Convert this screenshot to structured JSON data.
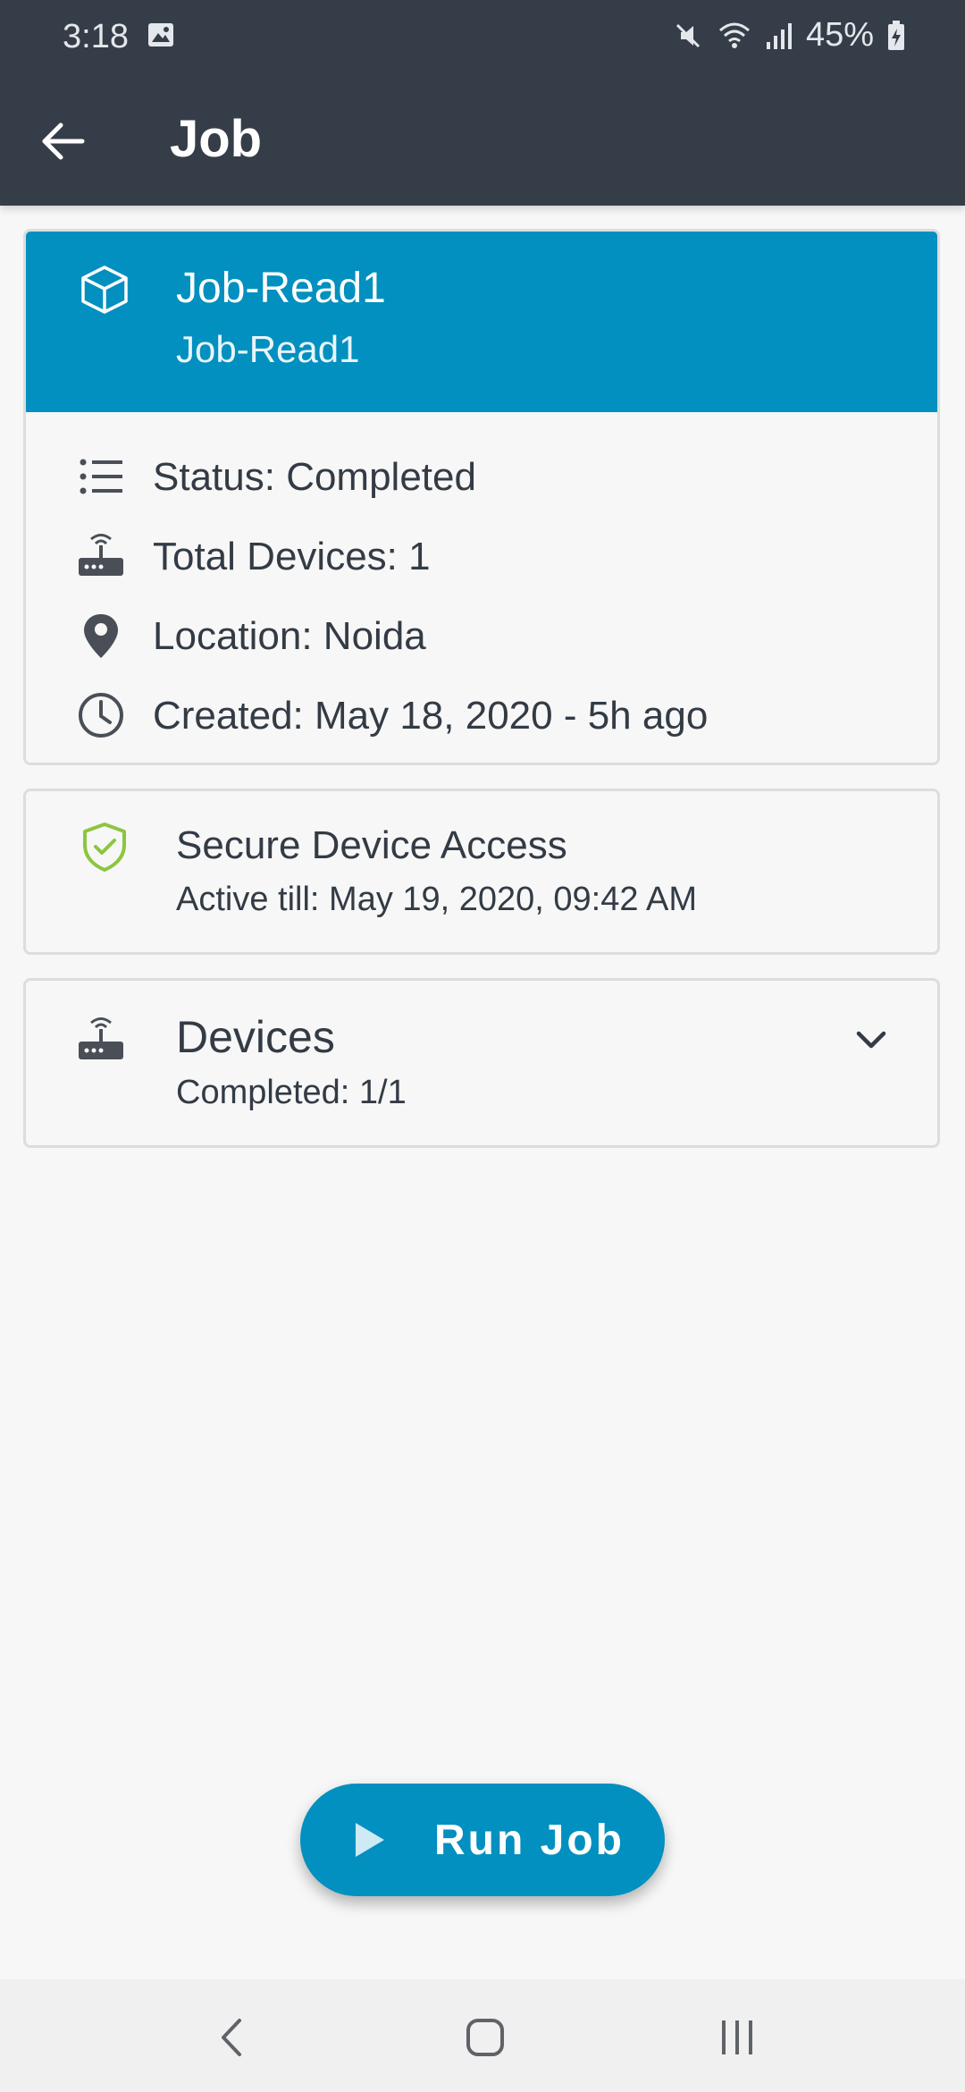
{
  "status_bar": {
    "time": "3:18",
    "battery": "45%"
  },
  "app_bar": {
    "title": "Job",
    "back_icon": "arrow-left-icon"
  },
  "job": {
    "name": "Job-Read1",
    "subtitle": "Job-Read1",
    "details": [
      {
        "icon": "list-icon",
        "text": "Status: Completed"
      },
      {
        "icon": "router-icon",
        "text": "Total Devices: 1"
      },
      {
        "icon": "location-pin-icon",
        "text": "Location: Noida"
      },
      {
        "icon": "clock-icon",
        "text": "Created: May 18, 2020 - 5h ago"
      }
    ]
  },
  "secure_access": {
    "title": "Secure Device Access",
    "active_till": "Active till: May 19, 2020, 09:42 AM"
  },
  "devices": {
    "title": "Devices",
    "completed": "Completed: 1/1"
  },
  "run_button": {
    "label": "Run Job"
  },
  "colors": {
    "app_bar": "#353d48",
    "accent": "#0190bf",
    "shield_green": "#8cc63f",
    "background": "#f7f7f7"
  }
}
